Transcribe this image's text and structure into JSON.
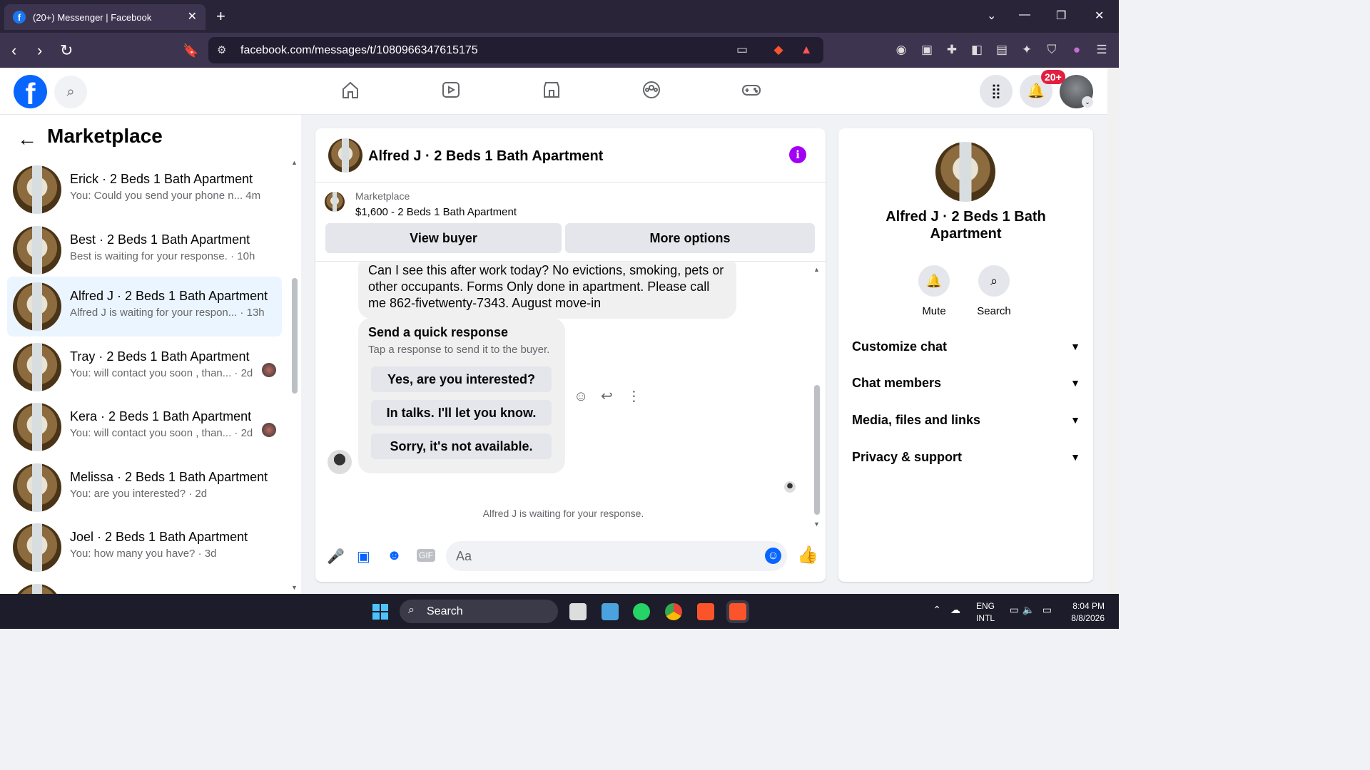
{
  "browser": {
    "tab_title": "(20+) Messenger | Facebook",
    "url": "facebook.com/messages/t/1080966347615175"
  },
  "header": {
    "notif_badge": "20+"
  },
  "sidebar": {
    "title": "Marketplace",
    "conversations": [
      {
        "name": "Erick · 2 Beds 1 Bath Apartment",
        "preview": "You: Could you send your phone n... 4m"
      },
      {
        "name": "Best · 2 Beds 1 Bath Apartment",
        "preview": "Best is waiting for your response. · 10h"
      },
      {
        "name": "Alfred J · 2 Beds 1 Bath Apartment",
        "preview": "Alfred J is waiting for your respon... · 13h"
      },
      {
        "name": "Tray · 2 Beds 1 Bath Apartment",
        "preview": "You: will contact you soon , than... · 2d"
      },
      {
        "name": "Kera · 2 Beds 1 Bath Apartment",
        "preview": "You: will contact you soon , than... · 2d"
      },
      {
        "name": "Melissa · 2 Beds 1 Bath Apartment",
        "preview": "You: are you interested? · 2d"
      },
      {
        "name": "Joel · 2 Beds 1 Bath Apartment",
        "preview": "You: how many you have? · 3d"
      }
    ]
  },
  "chat": {
    "title": "Alfred J · 2 Beds 1 Bath Apartment",
    "marketplace_label": "Marketplace",
    "listing": "$1,600 - 2 Beds 1 Bath Apartment",
    "view_buyer": "View buyer",
    "more_options": "More options",
    "message": "Can I see this after work today? No evictions, smoking, pets or other occupants. Forms Only done in apartment. Please call me 862-fivetwenty-7343. August move-in",
    "quick_response": {
      "title": "Send a quick response",
      "subtitle": "Tap a response to send it to the buyer.",
      "options": [
        "Yes, are you interested?",
        "In talks. I'll let you know.",
        "Sorry, it's not available."
      ]
    },
    "waiting": "Alfred J is waiting for your response.",
    "composer_placeholder": "Aa"
  },
  "info": {
    "name": "Alfred J · 2 Beds 1 Bath Apartment",
    "mute": "Mute",
    "search": "Search",
    "sections": [
      "Customize chat",
      "Chat members",
      "Media, files and links",
      "Privacy & support"
    ]
  },
  "taskbar": {
    "search": "Search",
    "lang1": "ENG",
    "lang2": "INTL",
    "time": "8:04 PM",
    "date": "8/8/2026"
  }
}
